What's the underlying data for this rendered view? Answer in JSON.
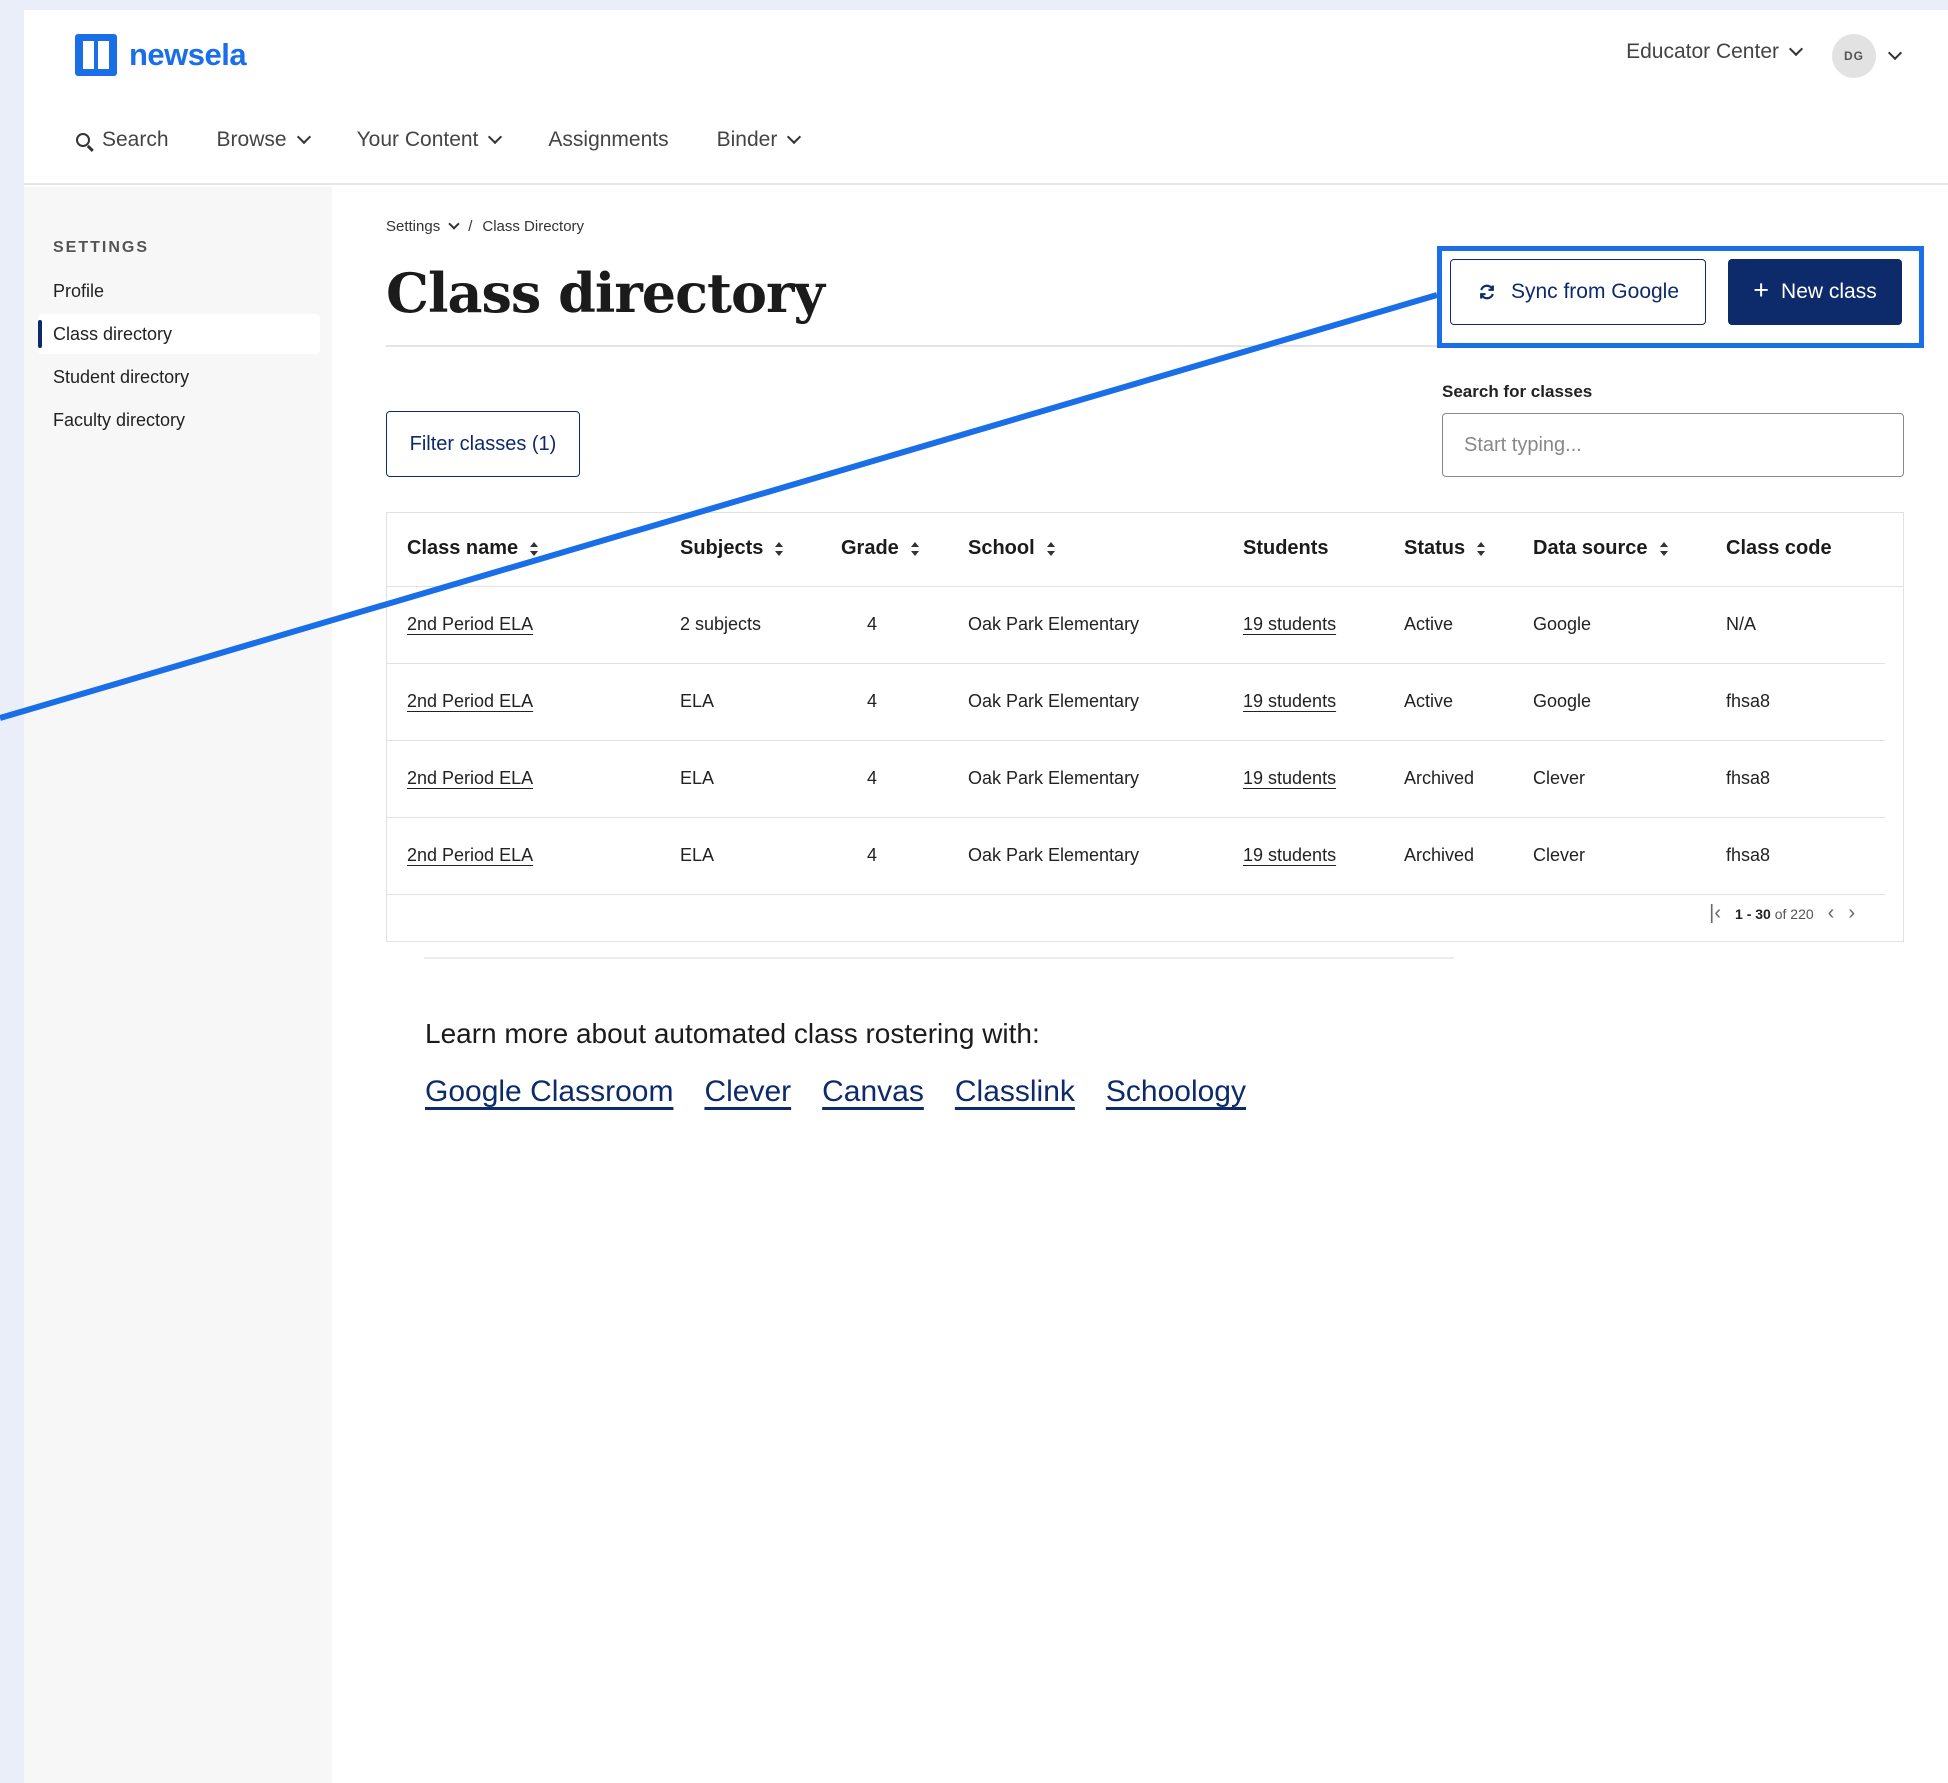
{
  "brand": {
    "name": "newsela",
    "color": "#1a6fe8"
  },
  "header": {
    "educator_center": "Educator Center",
    "avatar_initials": "DG",
    "nav": [
      {
        "label": "Search",
        "icon": "search-icon"
      },
      {
        "label": "Browse",
        "icon": "chevron-down-icon"
      },
      {
        "label": "Your Content",
        "icon": "chevron-down-icon"
      },
      {
        "label": "Assignments"
      },
      {
        "label": "Binder",
        "icon": "chevron-down-icon"
      }
    ]
  },
  "sidebar": {
    "heading": "SETTINGS",
    "items": [
      {
        "label": "Profile",
        "active": false
      },
      {
        "label": "Class directory",
        "active": true
      },
      {
        "label": "Student directory",
        "active": false
      },
      {
        "label": "Faculty directory",
        "active": false
      }
    ]
  },
  "breadcrumb": {
    "root": "Settings",
    "separator": "/",
    "current": "Class Directory"
  },
  "page": {
    "title": "Class directory",
    "sync_button": "Sync from Google",
    "new_button": "New class",
    "filter_button": "Filter classes (1)",
    "search_label": "Search for classes",
    "search_placeholder": "Start typing..."
  },
  "table": {
    "columns": [
      "Class name",
      "Subjects",
      "Grade",
      "School",
      "Students",
      "Status",
      "Data source",
      "Class code"
    ],
    "rows": [
      [
        "2nd Period ELA",
        "2 subjects",
        "4",
        "Oak Park Elementary",
        "19 students",
        "Active",
        "Google",
        "N/A"
      ],
      [
        "2nd Period ELA",
        "ELA",
        "4",
        "Oak Park Elementary",
        "19 students",
        "Active",
        "Google",
        "fhsa8"
      ],
      [
        "2nd Period ELA",
        "ELA",
        "4",
        "Oak Park Elementary",
        "19 students",
        "Archived",
        "Clever",
        "fhsa8"
      ],
      [
        "2nd Period ELA",
        "ELA",
        "4",
        "Oak Park Elementary",
        "19 students",
        "Archived",
        "Clever",
        "fhsa8"
      ]
    ],
    "pager": {
      "range": "1 - 30",
      "of_text": "of 220"
    }
  },
  "learn_more": {
    "text": "Learn more about automated class rostering with:",
    "links": [
      "Google Classroom",
      "Clever",
      "Canvas",
      "Classlink",
      "Schoology"
    ]
  },
  "colors": {
    "primary": "#0d2a6b",
    "highlight": "#1a6fe8"
  }
}
